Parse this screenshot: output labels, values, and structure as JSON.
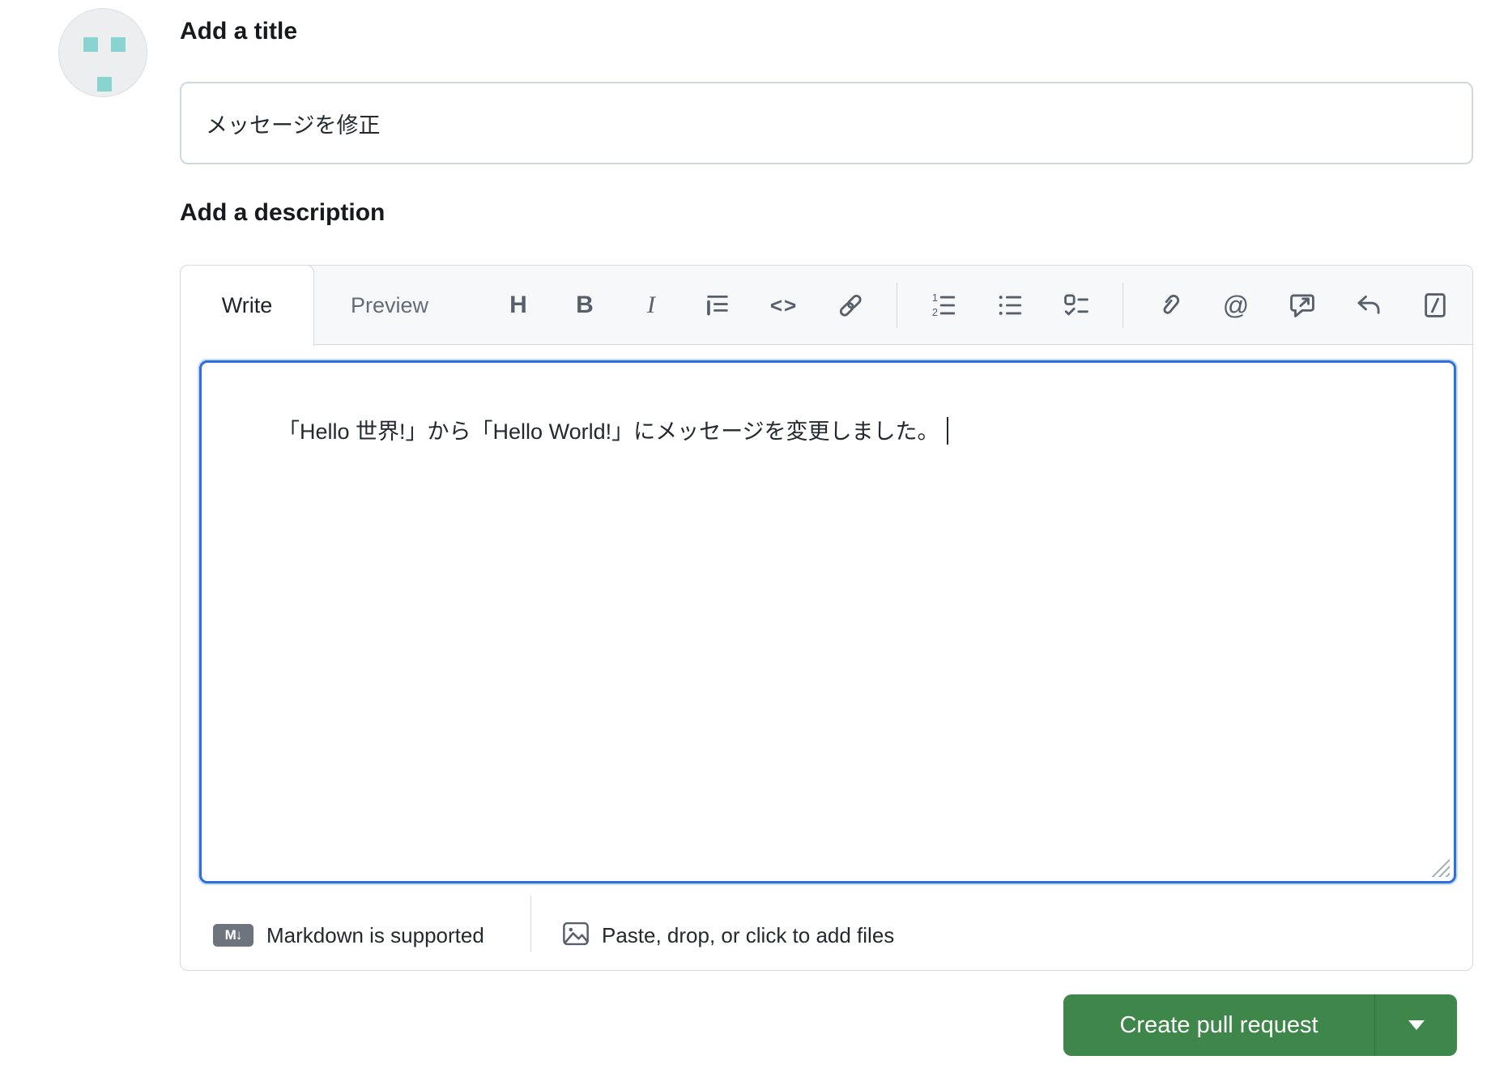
{
  "title_section": {
    "heading": "Add a title",
    "value": "メッセージを修正"
  },
  "description_section": {
    "heading": "Add a description",
    "tabs": {
      "write": "Write",
      "preview": "Preview"
    },
    "toolbar_glyphs": {
      "heading": "H",
      "bold": "B",
      "italic": "I",
      "code": "<>",
      "mention": "@"
    },
    "editor": {
      "text": "「Hello 世界!」から「Hello World!」にメッセージを変更しました。"
    },
    "footer": {
      "markdown_badge": "M↓",
      "markdown_note": "Markdown is supported",
      "paste_note": "Paste, drop, or click to add files"
    }
  },
  "actions": {
    "create_pull_request": "Create pull request"
  },
  "colors": {
    "accent_green": "#3e8649",
    "focus_blue": "#2d6ee0",
    "avatar_teal": "#89d3d1",
    "border_gray": "#d4dae0",
    "toolbar_bg": "#f6f8fa",
    "icon_gray": "#57606a"
  }
}
